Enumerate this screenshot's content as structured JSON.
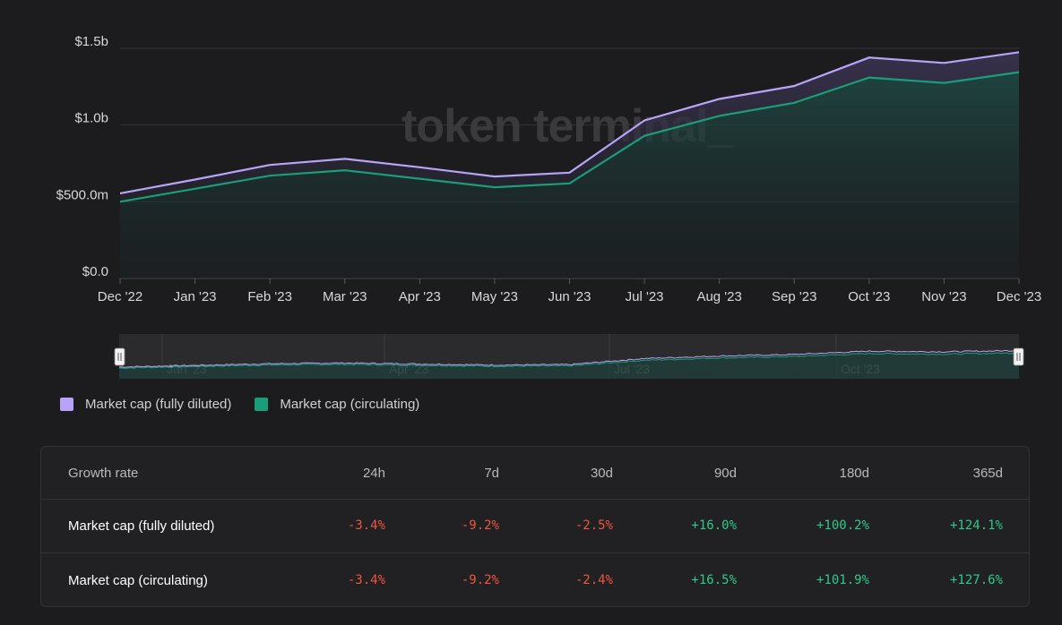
{
  "watermark": "token terminal_",
  "colors": {
    "fully_diluted": "#b7a4f8",
    "circulating": "#1a9e7a",
    "negative": "#f0553d",
    "positive": "#2ec98a"
  },
  "chart_data": {
    "type": "line",
    "title": "",
    "xlabel": "",
    "ylabel": "",
    "categories": [
      "Dec '22",
      "Jan '23",
      "Feb '23",
      "Mar '23",
      "Apr '23",
      "May '23",
      "Jun '23",
      "Jul '23",
      "Aug '23",
      "Sep '23",
      "Oct '23",
      "Nov '23",
      "Dec '23"
    ],
    "y_ticks": [
      "$0.0",
      "$500.0m",
      "$1.0b",
      "$1.5b"
    ],
    "ylim": [
      0,
      1500000000
    ],
    "grid": true,
    "series": [
      {
        "name": "Market cap (fully diluted)",
        "values": [
          555,
          645,
          740,
          780,
          725,
          665,
          690,
          1030,
          1170,
          1255,
          1440,
          1405,
          1475
        ]
      },
      {
        "name": "Market cap (circulating)",
        "values": [
          500,
          585,
          670,
          705,
          650,
          595,
          620,
          930,
          1060,
          1145,
          1310,
          1275,
          1345
        ]
      }
    ],
    "value_unit": "millions USD",
    "legend_position": "bottom-left"
  },
  "navigator": {
    "labels": [
      "Jan '23",
      "Apr '23",
      "Jul '23",
      "Oct '23"
    ]
  },
  "legend": [
    {
      "label": "Market cap (fully diluted)"
    },
    {
      "label": "Market cap (circulating)"
    }
  ],
  "table": {
    "header": {
      "label": "Growth rate",
      "cols": [
        "24h",
        "7d",
        "30d",
        "90d",
        "180d",
        "365d"
      ]
    },
    "rows": [
      {
        "label": "Market cap (fully diluted)",
        "values": [
          "-3.4%",
          "-9.2%",
          "-2.5%",
          "+16.0%",
          "+100.2%",
          "+124.1%"
        ]
      },
      {
        "label": "Market cap (circulating)",
        "values": [
          "-3.4%",
          "-9.2%",
          "-2.4%",
          "+16.5%",
          "+101.9%",
          "+127.6%"
        ]
      }
    ]
  }
}
